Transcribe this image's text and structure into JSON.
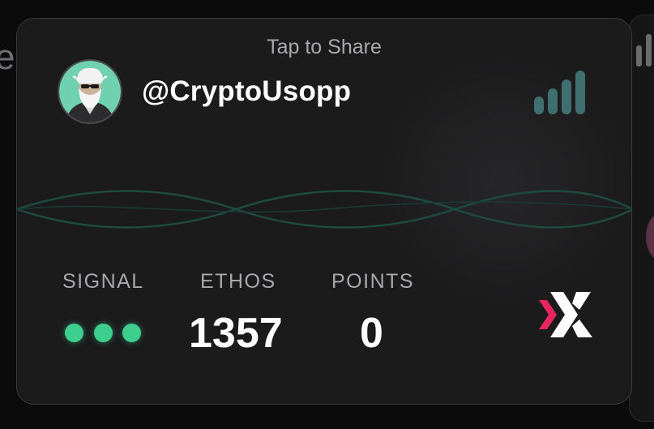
{
  "card": {
    "tap_to_share": "Tap to Share",
    "username": "@CryptoUsopp",
    "avatar_icon": "bearded-man-avatar",
    "signal_bars_icon": "signal-strength-icon",
    "signal_bars_level": 4,
    "stats": {
      "signal": {
        "label": "SIGNAL",
        "dots_active": 3,
        "dots_total": 3
      },
      "ethos": {
        "label": "ETHOS",
        "value": "1357"
      },
      "points": {
        "label": "POINTS",
        "value": "0"
      }
    },
    "brand_icon": "x-brand-logo"
  },
  "background": {
    "left_partial_letter": "e"
  },
  "colors": {
    "card_bg": "#1b1b1c",
    "accent_teal": "#3f6f6e",
    "dot_green": "#3ecf8e",
    "logo_pink": "#e8265e",
    "text_primary": "#ffffff",
    "text_muted": "#a8a8ac"
  }
}
